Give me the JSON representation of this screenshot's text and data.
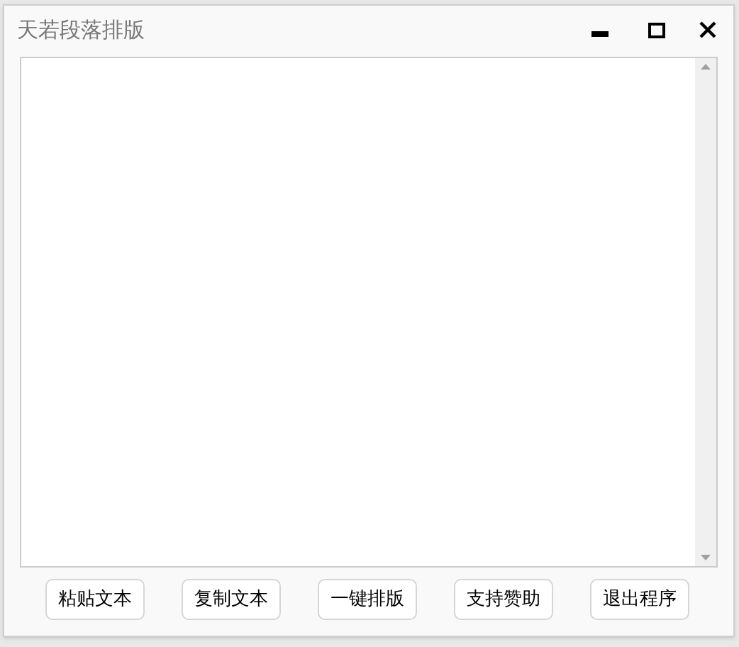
{
  "window": {
    "title": "天若段落排版"
  },
  "buttons": [
    "粘贴文本",
    "复制文本",
    "一键排版",
    "支持赞助",
    "退出程序"
  ]
}
